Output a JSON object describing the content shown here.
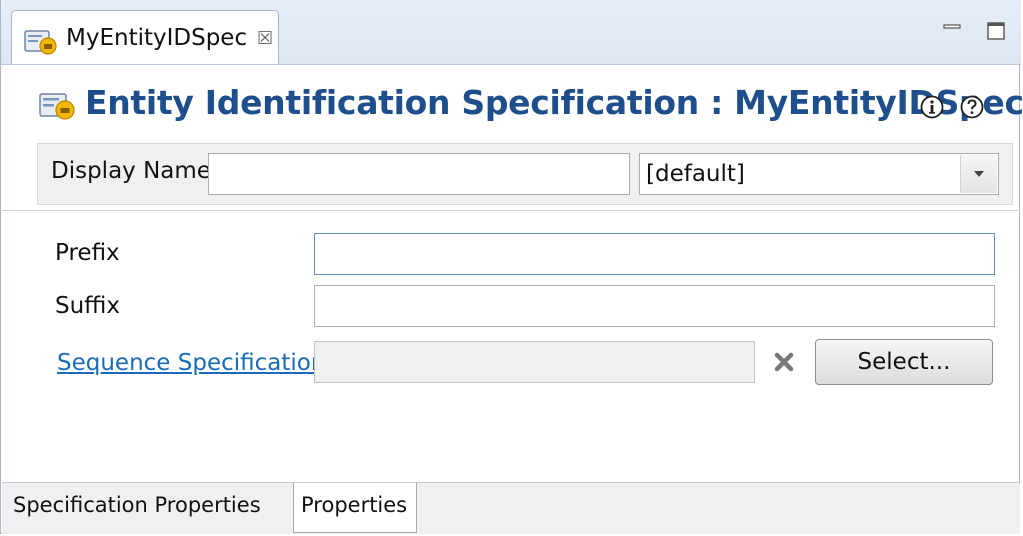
{
  "editor_tab": {
    "label": "MyEntityIDSpec",
    "close_glyph": "☒"
  },
  "header": {
    "title": "Entity Identification Specification : MyEntityIDSpec"
  },
  "display_name": {
    "label": "Display Name",
    "value": "",
    "locale_selected": "[default]"
  },
  "fields": {
    "prefix_label": "Prefix",
    "prefix_value": "",
    "suffix_label": "Suffix",
    "suffix_value": "",
    "sequence_link": "Sequence Specification",
    "sequence_value": "",
    "select_button": "Select..."
  },
  "bottom_tabs": [
    {
      "label": "Specification Properties"
    },
    {
      "label": "Properties"
    }
  ],
  "icons": {
    "entity_spec": "entity-spec-icon",
    "close": "close-icon",
    "minimize": "minimize-icon",
    "maximize": "maximize-icon",
    "info": "info-icon",
    "help": "help-icon",
    "dropdown": "chevron-down-icon",
    "clear": "clear-icon"
  },
  "colors": {
    "title": "#1e4f8c",
    "link": "#1a6bb8",
    "accent_icon": "#f2b705"
  }
}
